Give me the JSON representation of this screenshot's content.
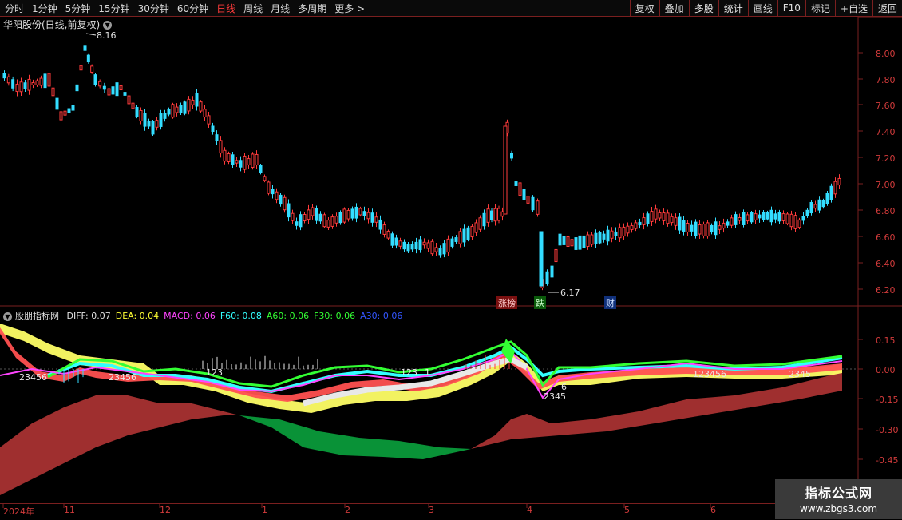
{
  "toolbar": {
    "periods": [
      "分时",
      "1分钟",
      "5分钟",
      "15分钟",
      "30分钟",
      "60分钟",
      "日线",
      "周线",
      "月线",
      "多周期",
      "更多 >"
    ],
    "active_period": "日线",
    "actions": [
      "复权",
      "叠加",
      "多股",
      "统计",
      "画线",
      "F10",
      "标记",
      "+自选",
      "返回"
    ]
  },
  "stock": {
    "title": "华阳股份(日线,前复权)",
    "high_label": "8.16",
    "low_label": "6.17"
  },
  "price_axis": [
    "8.00",
    "7.80",
    "7.60",
    "7.40",
    "7.20",
    "7.00",
    "6.80",
    "6.60",
    "6.40",
    "6.20"
  ],
  "events": {
    "limit_up": "涨榜",
    "fall": "跌",
    "finance": "财"
  },
  "indicator": {
    "name": "股朋指标网",
    "items": [
      {
        "label": "DIFF: 0.07",
        "color": "#e0e0e0"
      },
      {
        "label": "DEA: 0.04",
        "color": "#ffff33"
      },
      {
        "label": "MACD: 0.06",
        "color": "#ff44ff"
      },
      {
        "label": "F60: 0.08",
        "color": "#33ffff"
      },
      {
        "label": "A60: 0.06",
        "color": "#33ff33"
      },
      {
        "label": "F30: 0.06",
        "color": "#33ff33"
      },
      {
        "label": "A30: 0.06",
        "color": "#3355ff"
      }
    ],
    "axis": [
      "0.15",
      "0.00",
      "-0.15",
      "-0.30",
      "-0.45"
    ],
    "wave_labels": [
      "23456",
      "23456",
      "123",
      "123",
      "1",
      "2345",
      "6",
      "123456",
      "2345"
    ]
  },
  "date_axis": [
    "2024年",
    "11",
    "12",
    "1",
    "2",
    "3",
    "4",
    "5",
    "6"
  ],
  "watermark": {
    "line1": "指标公式网",
    "line2": "www.zbgs3.com"
  }
}
